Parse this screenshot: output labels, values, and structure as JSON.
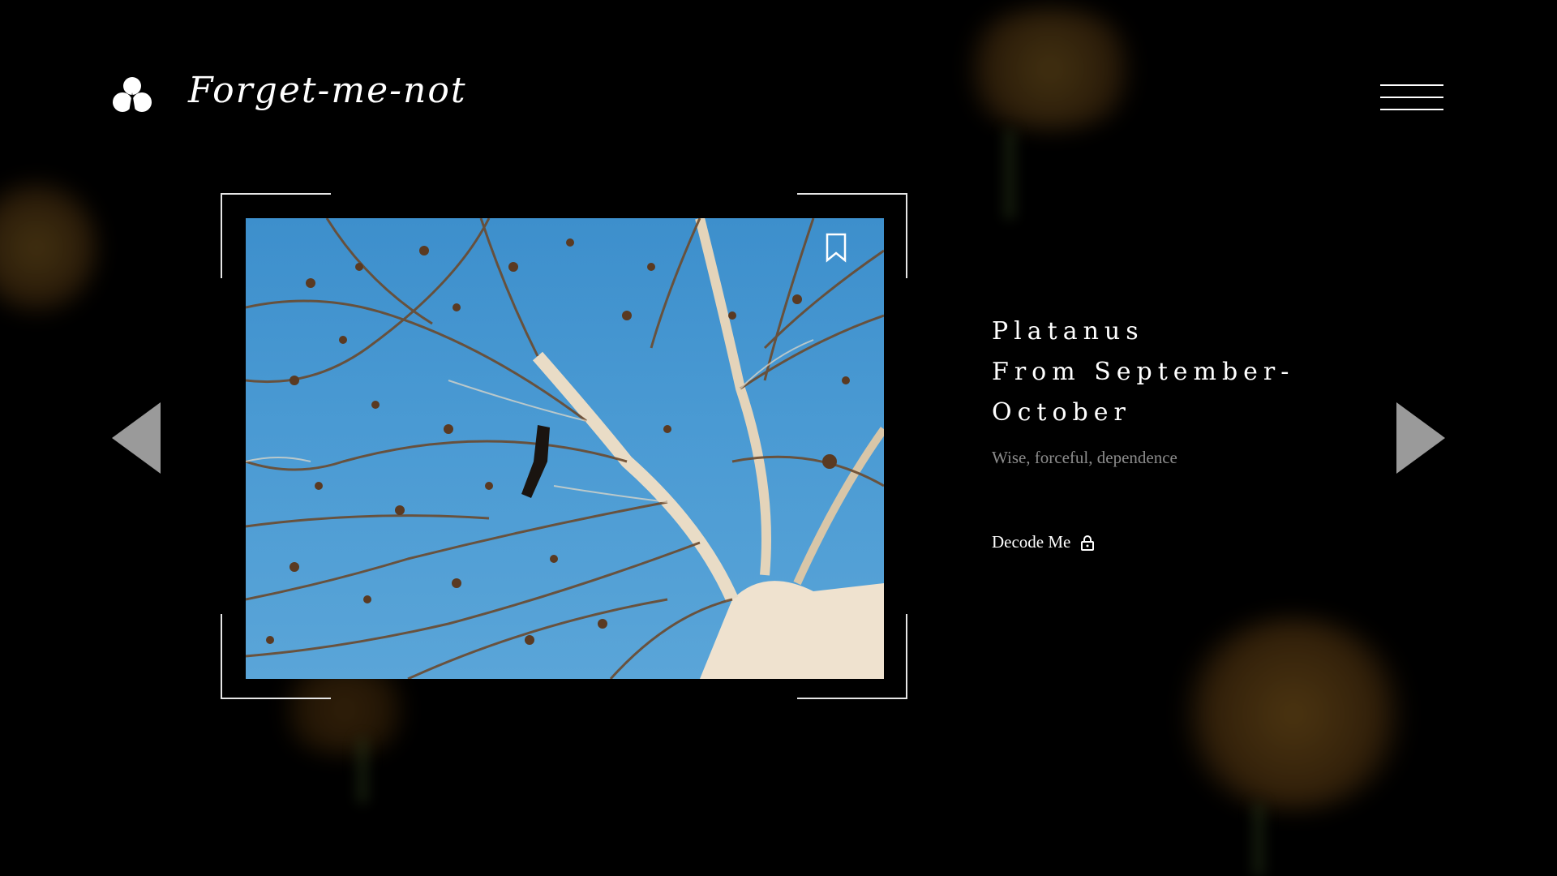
{
  "brand": {
    "name": "Forget-me-not",
    "logo_icon": "trefoil-drop-icon"
  },
  "header": {
    "menu_icon": "hamburger-menu-icon"
  },
  "card": {
    "title_line1": "Platanus",
    "title_line2": "From September-",
    "title_line3": "October",
    "meanings": "Wise, forceful, dependence",
    "decode_label": "Decode Me",
    "decode_icon": "lock-icon",
    "bookmark_icon": "bookmark-icon",
    "image_subject": "bare plane tree branches against blue sky"
  },
  "nav": {
    "prev_icon": "triangle-left-icon",
    "next_icon": "triangle-right-icon"
  },
  "colors": {
    "background": "#000000",
    "text": "#ffffff",
    "muted": "#8c8c8c",
    "arrow": "#9a9a9a",
    "sky": "#4a9ad3"
  }
}
